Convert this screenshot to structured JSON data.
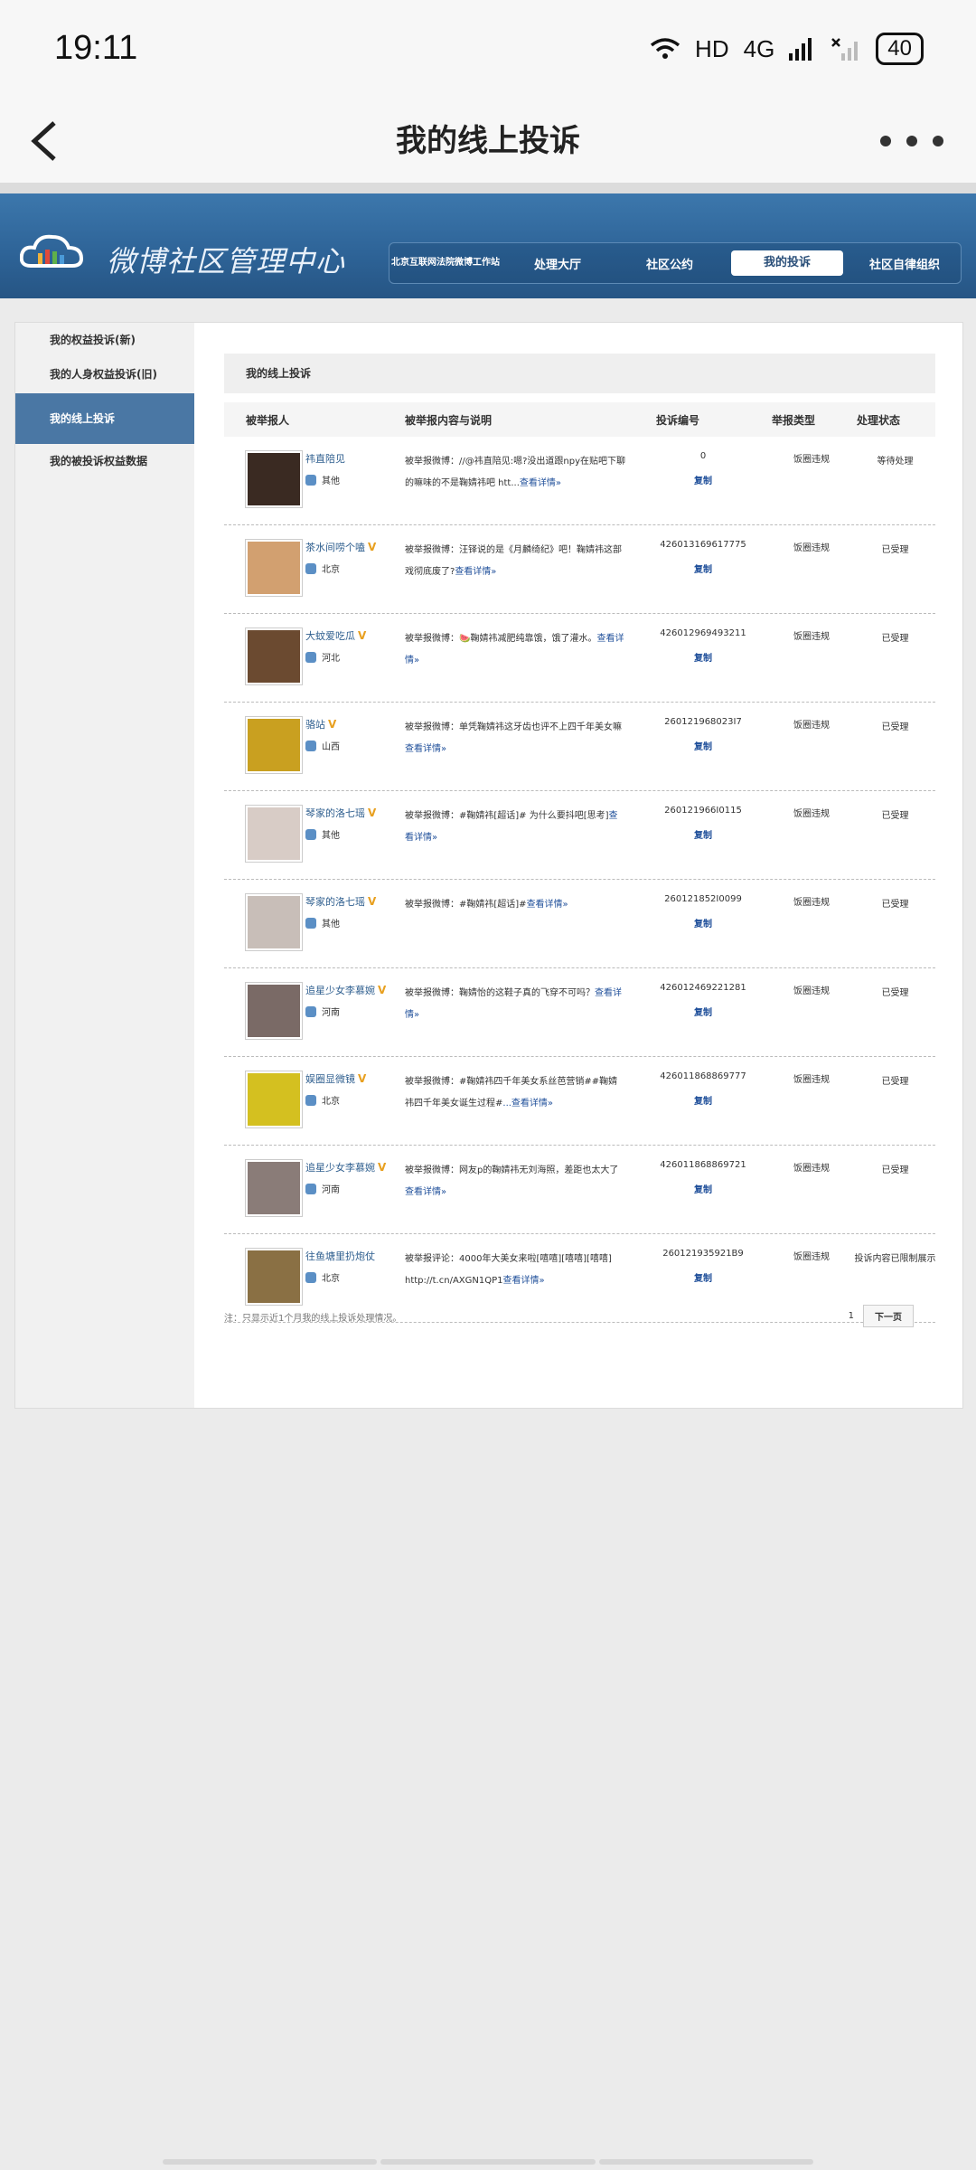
{
  "status_bar": {
    "time": "19:11",
    "network": "HD",
    "signal": "4G",
    "battery": "40"
  },
  "header": {
    "title": "我的线上投诉"
  },
  "banner": {
    "logo_text": "微博社区管理中心",
    "nav": [
      {
        "label": "北京互联网法院微博工作站"
      },
      {
        "label": "处理大厅"
      },
      {
        "label": "社区公约"
      },
      {
        "label": "我的投诉"
      },
      {
        "label": "社区自律组织"
      }
    ]
  },
  "sidebar": {
    "items": [
      {
        "label": "我的权益投诉(新)"
      },
      {
        "label": "我的人身权益投诉(旧)"
      },
      {
        "label": "我的线上投诉"
      },
      {
        "label": "我的被投诉权益数据"
      }
    ]
  },
  "main": {
    "box_title": "我的线上投诉",
    "columns": [
      "被举报人",
      "被举报内容与说明",
      "投诉编号",
      "举报类型",
      "处理状态"
    ],
    "copy_label": "复制",
    "rows": [
      {
        "name": "祎直陪见",
        "location": "其他",
        "desc": "被举报微博：//@祎直陪见:嗯?没出道跟npy在贴吧下聊的嘛味的不是鞠婧祎吧 htt...",
        "more": "查看详情»",
        "id": "0",
        "type": "饭圈违规",
        "status": "等待处理"
      },
      {
        "name": "茶水间唠个嗑",
        "location": "北京",
        "desc": "被举报微博：汪铎说的是《月麟绮纪》吧！鞠婧祎这部戏彻底废了?",
        "more": "查看详情»",
        "id": "426013169617775",
        "type": "饭圈违规",
        "status": "已受理"
      },
      {
        "name": "大蚊爱吃瓜",
        "location": "河北",
        "desc": "被举报微博：🍉鞠婧祎减肥纯靠饿，饿了灌水。",
        "more": "查看详情»",
        "id": "426012969493211",
        "type": "饭圈违规",
        "status": "已受理"
      },
      {
        "name": "骆站",
        "location": "山西",
        "desc": "被举报微博：单凭鞠婧祎这牙齿也评不上四千年美女嘛",
        "more": "查看详情»",
        "id": "260121968023I7",
        "type": "饭圈违规",
        "status": "已受理"
      },
      {
        "name": "琴家的洛七瑶",
        "location": "其他",
        "desc": "被举报微博：#鞠婧祎[超话]# 为什么要抖吧[思考]",
        "more": "查看详情»",
        "id": "260121966I0115",
        "type": "饭圈违规",
        "status": "已受理"
      },
      {
        "name": "琴家的洛七瑶",
        "location": "其他",
        "desc": "被举报微博：#鞠婧祎[超话]#",
        "more": "查看详情»",
        "id": "260121852I0099",
        "type": "饭圈违规",
        "status": "已受理"
      },
      {
        "name": "追星少女李慕婉",
        "location": "河南",
        "desc": "被举报微博：鞠婧怡的这鞋子真的飞穿不可吗？",
        "more": "查看详情»",
        "id": "426012469221281",
        "type": "饭圈违规",
        "status": "已受理"
      },
      {
        "name": "娱圈显微镜",
        "location": "北京",
        "desc": "被举报微博：#鞠婧祎四千年美女系丝芭营销##鞠婧祎四千年美女诞生过程#",
        "more": "...查看详情»",
        "id": "426011868869777",
        "type": "饭圈违规",
        "status": "已受理"
      },
      {
        "name": "追星少女李慕婉",
        "location": "河南",
        "desc": "被举报微博：网友p的鞠婧祎无刘海照，差距也太大了",
        "more": "查看详情»",
        "id": "426011868869721",
        "type": "饭圈违规",
        "status": "已受理"
      },
      {
        "name": "往鱼塘里扔炮仗",
        "location": "北京",
        "desc": "被举报评论：4000年大美女来啦[嘻嘻][嘻嘻][嘻嘻] http://t.cn/AXGN1QP1",
        "more": "查看详情»",
        "id": "260121935921B9",
        "type": "饭圈违规",
        "status": "投诉内容已限制展示"
      }
    ],
    "footer_note": "注：只显示近1个月我的线上投诉处理情况。",
    "pager": {
      "current": "1",
      "next": "下一页"
    }
  }
}
